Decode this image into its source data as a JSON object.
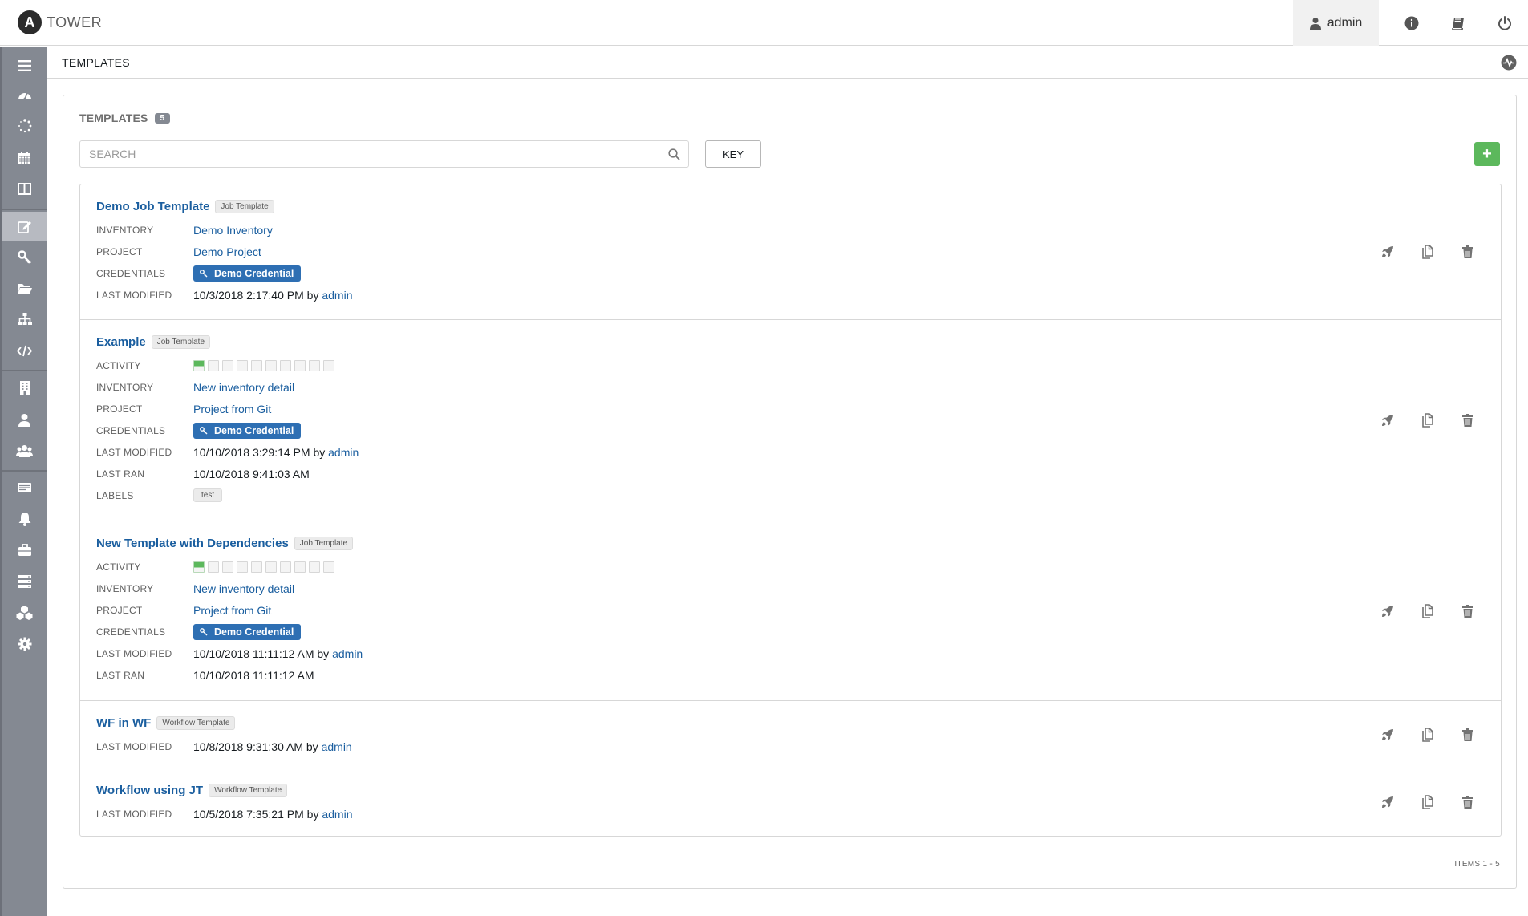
{
  "header": {
    "logo_letter": "A",
    "app_name": "TOWER",
    "user": "admin"
  },
  "breadcrumb": "TEMPLATES",
  "panel": {
    "title": "TEMPLATES",
    "count": "5",
    "search_placeholder": "SEARCH",
    "key_label": "KEY",
    "add_label": "+",
    "items_count": "ITEMS  1 - 5"
  },
  "labels": {
    "inventory": "INVENTORY",
    "project": "PROJECT",
    "credentials": "CREDENTIALS",
    "last_modified": "LAST MODIFIED",
    "activity": "ACTIVITY",
    "last_ran": "LAST RAN",
    "labels": "LABELS",
    "by": "by"
  },
  "templates": [
    {
      "name": "Demo Job Template",
      "type": "Job Template",
      "inventory": "Demo Inventory",
      "project": "Demo Project",
      "credential": "Demo Credential",
      "last_modified": "10/3/2018 2:17:40 PM",
      "modified_by": "admin"
    },
    {
      "name": "Example",
      "type": "Job Template",
      "activity": [
        "successful",
        "none",
        "none",
        "none",
        "none",
        "none",
        "none",
        "none",
        "none",
        "none"
      ],
      "inventory": "New inventory detail",
      "project": "Project from Git",
      "credential": "Demo Credential",
      "last_modified": "10/10/2018 3:29:14 PM",
      "modified_by": "admin",
      "last_ran": "10/10/2018 9:41:03 AM",
      "label": "test"
    },
    {
      "name": "New Template with Dependencies",
      "type": "Job Template",
      "activity": [
        "successful",
        "none",
        "none",
        "none",
        "none",
        "none",
        "none",
        "none",
        "none",
        "none"
      ],
      "inventory": "New inventory detail",
      "project": "Project from Git",
      "credential": "Demo Credential",
      "last_modified": "10/10/2018 11:11:12 AM",
      "modified_by": "admin",
      "last_ran": "10/10/2018 11:11:12 AM"
    },
    {
      "name": "WF in WF",
      "type": "Workflow Template",
      "last_modified": "10/8/2018 9:31:30 AM",
      "modified_by": "admin"
    },
    {
      "name": "Workflow using JT",
      "type": "Workflow Template",
      "last_modified": "10/5/2018 7:35:21 PM",
      "modified_by": "admin"
    }
  ],
  "icons": {
    "header": [
      "user-icon",
      "info-icon",
      "docs-book-icon",
      "logout-power-icon"
    ],
    "sidebar": [
      "menu-icon",
      "dashboard-icon",
      "jobs-spinner-icon",
      "schedules-calendar-icon",
      "my-view-icon",
      "templates-edit-icon",
      "credentials-key-icon",
      "projects-folder-icon",
      "inventories-sitemap-icon",
      "inventory-scripts-code-icon",
      "organizations-building-icon",
      "users-icon",
      "teams-icon",
      "credential-types-icon",
      "notifications-bell-icon",
      "management-jobs-briefcase-icon",
      "instance-groups-server-icon",
      "applications-cubes-icon",
      "settings-gear-icon"
    ],
    "row_actions": [
      "launch-rocket-icon",
      "copy-icon",
      "delete-trash-icon"
    ]
  },
  "colors": {
    "accent_link": "#1a5e9f",
    "credential_badge": "#2e6fb3",
    "add_button": "#5cb85c",
    "sidebar": "#848992",
    "activity_success": "#5cb85c"
  }
}
